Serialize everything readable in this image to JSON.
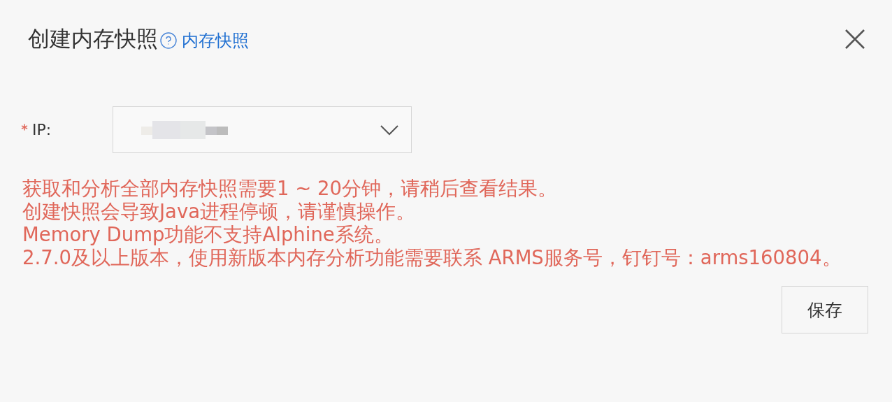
{
  "dialog": {
    "title": "创建内存快照",
    "help_link": "内存快照"
  },
  "form": {
    "fields": [
      {
        "label": "IP:",
        "required": true,
        "kind": "select"
      }
    ]
  },
  "messages": [
    "获取和分析全部内存快照需要1 ~ 20分钟，请稍后查看结果。",
    "创建快照会导致Java进程停顿，请谨慎操作。",
    "Memory Dump功能不支持Alphine系统。",
    "2.7.0及以上版本，使用新版本内存分析功能需要联系 ARMS服务号，钉钉号：arms160804。"
  ],
  "buttons": [
    {
      "label": "保存"
    }
  ]
}
